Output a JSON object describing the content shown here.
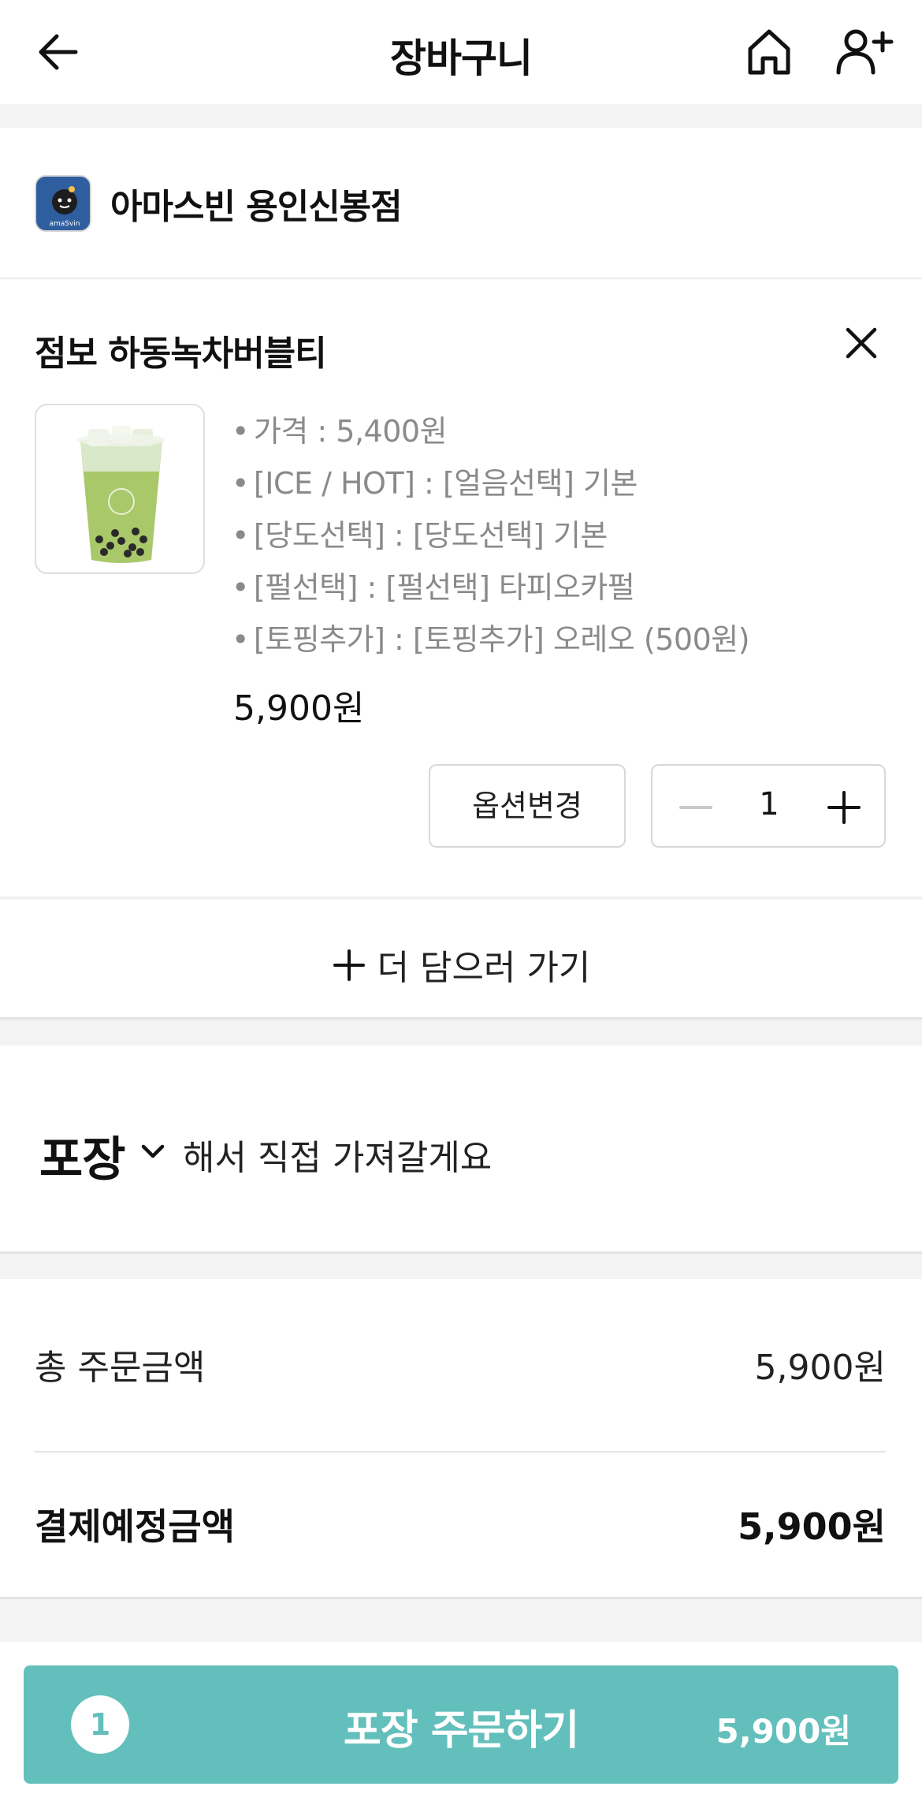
{
  "header": {
    "title": "장바구니"
  },
  "store": {
    "name": "아마스빈 용인신봉점",
    "logo_text": "amaSvin"
  },
  "cart_item": {
    "name": "점보 하동녹차버블티",
    "options": [
      "가격 : 5,400원",
      "[ICE / HOT] : [얼음선택] 기본",
      "[당도선택] : [당도선택] 기본",
      "[펄선택] : [펄선택] 타피오카펄",
      "[토핑추가] : [토핑추가] 오레오 (500원)"
    ],
    "price": "5,900원",
    "option_change_label": "옵션변경",
    "quantity": "1"
  },
  "add_more_label": "더 담으러 가기",
  "pickup": {
    "type": "포장",
    "description": "해서 직접 가져갈게요"
  },
  "summary": {
    "total_label": "총 주문금액",
    "total_value": "5,900원",
    "payment_label": "결제예정금액",
    "payment_value": "5,900원"
  },
  "order_button": {
    "count": "1",
    "label": "포장 주문하기",
    "amount": "5,900원"
  },
  "colors": {
    "accent": "#63bfbb",
    "background": "#f3f3f3",
    "logo_bg": "#2f5e9e"
  }
}
